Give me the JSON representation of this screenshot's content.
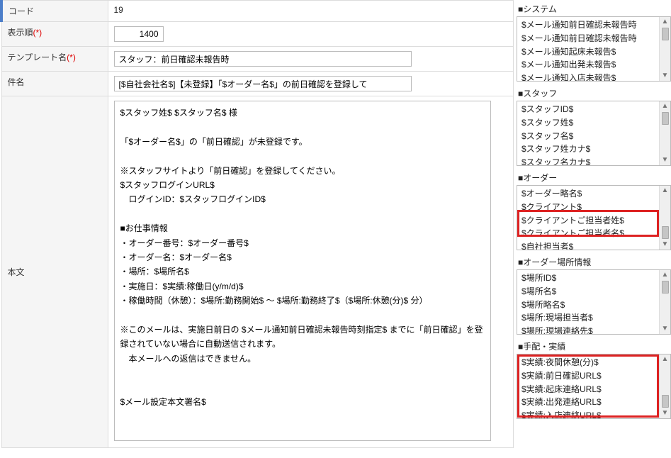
{
  "form": {
    "code_label": "コード",
    "code_value": "19",
    "order_label": "表示順",
    "order_value": "1400",
    "template_label": "テンプレート名",
    "template_value": "スタッフ：前日確認未報告時",
    "subject_label": "件名",
    "subject_value": "[$自社会社名$]【未登録】「$オーダー名$」の前日確認を登録して",
    "body_label": "本文",
    "body_value": "$スタッフ姓$ $スタッフ名$ 様\n\n「$オーダー名$」の「前日確認」が未登録です。\n\n※スタッフサイトより「前日確認」を登録してください。\n$スタッフログインURL$\n　ログインID：$スタッフログインID$\n\n■お仕事情報\n・オーダー番号：$オーダー番号$\n・オーダー名：$オーダー名$\n・場所：$場所名$\n・実施日：$実績:稼働日(y/m/d)$\n・稼働時間（休憩）：$場所:勤務開始$ ～ $場所:勤務終了$（$場所:休憩(分)$ 分）\n\n※このメールは、実施日前日の $メール通知前日確認未報告時刻指定$ までに「前日確認」を登録されていない場合に自動送信されます。\n　本メールへの返信はできません。\n\n\n$メール設定本文署名$",
    "req_marker": "(*)"
  },
  "right": {
    "sections": [
      {
        "title": "■システム",
        "items": [
          "$メール通知前日確認未報告時",
          "$メール通知前日確認未報告時",
          "$メール通知起床未報告$",
          "$メール通知出発未報告$",
          "$メール通知入店未報告$"
        ],
        "thumb_top": true,
        "highlight": null
      },
      {
        "title": "■スタッフ",
        "items": [
          "$スタッフID$",
          "$スタッフ姓$",
          "$スタッフ名$",
          "$スタッフ姓カナ$",
          "$スタッフ名カナ$"
        ],
        "thumb_top": true,
        "highlight": null
      },
      {
        "title": "■オーダー",
        "items": [
          "$オーダー略名$",
          "$クライアント$",
          "$クライアントご担当者姓$",
          "$クライアントご担当者名$",
          "$自社担当者$"
        ],
        "thumb_top": false,
        "highlight": {
          "from": 2,
          "to": 3
        }
      },
      {
        "title": "■オーダー場所情報",
        "items": [
          "$場所ID$",
          "$場所名$",
          "$場所略名$",
          "$場所:現場担当者$",
          "$場所:現場連絡先$"
        ],
        "thumb_top": true,
        "highlight": null
      },
      {
        "title": "■手配・実績",
        "items": [
          "$実績:夜間休憩(分)$",
          "$実績:前日確認URL$",
          "$実績:起床連絡URL$",
          "$実績:出発連絡URL$",
          "$実績:入店連絡URL$"
        ],
        "thumb_top": false,
        "highlight": {
          "from": 0,
          "to": 4
        }
      }
    ]
  }
}
